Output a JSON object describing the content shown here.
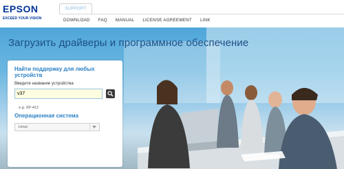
{
  "brand": {
    "name": "EPSON",
    "tagline": "EXCEED YOUR VISION",
    "color": "#003399"
  },
  "tabs": {
    "active": "SUPPORT"
  },
  "nav": {
    "items": [
      "DOWNLOAD",
      "FAQ",
      "MANUAL",
      "LICENSE AGREEMENT",
      "LINK"
    ]
  },
  "hero": {
    "title": "Загрузить драйверы и программное обеспечение"
  },
  "search_panel": {
    "title": "Найти поддержку для любых устройств",
    "label": "Введите название устройства",
    "input_value": "v37",
    "example": "e.g. XP-412",
    "search_icon": "magnifier-icon",
    "os_title": "Операционная система",
    "os_selected": "Linux"
  },
  "colors": {
    "accent": "#2a7fc4",
    "hero_title": "#1d4f86",
    "input_bg": "#fffde0"
  }
}
